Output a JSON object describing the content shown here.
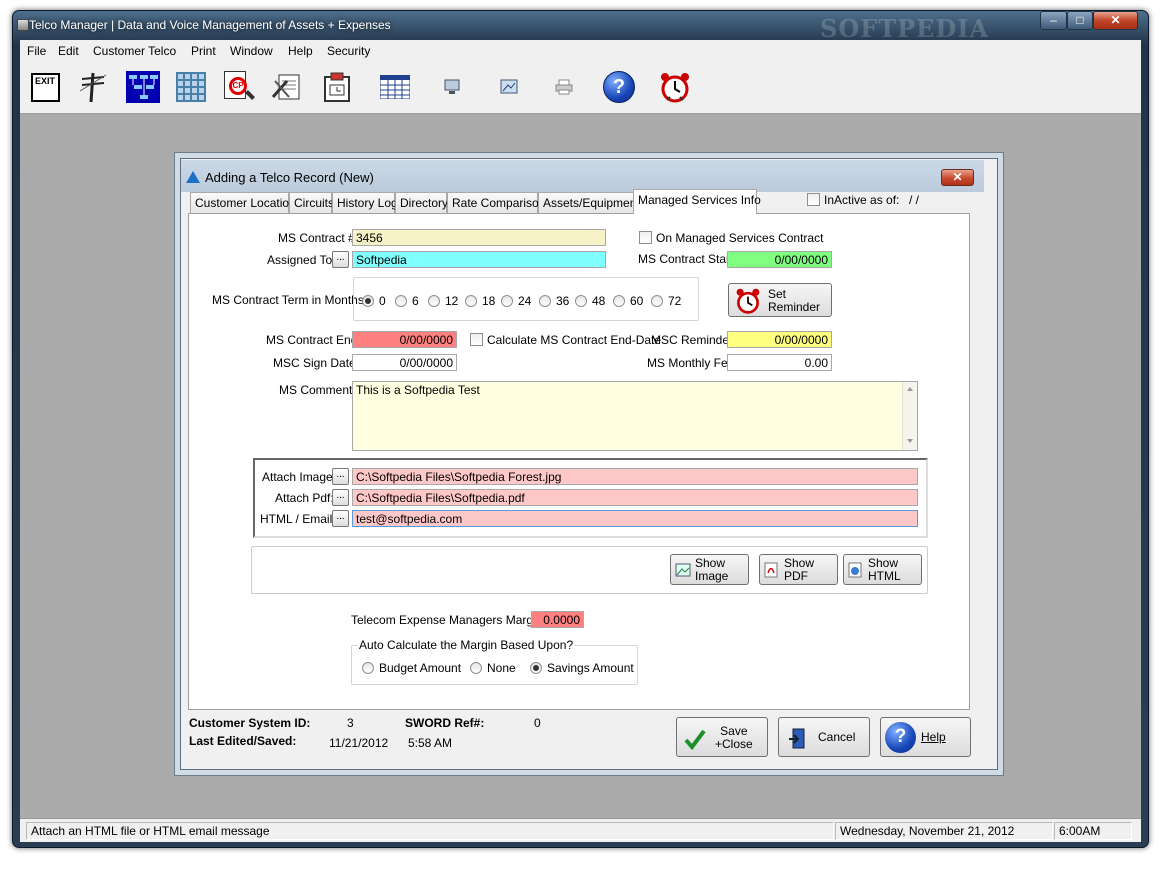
{
  "window": {
    "title": "Telco Manager | Data and Voice Management of Assets + Expenses",
    "watermark": "SOFTPEDIA",
    "min": "–",
    "max": "□",
    "close": "✕"
  },
  "menu": [
    "File",
    "Edit",
    "Customer Telco",
    "Print",
    "Window",
    "Help",
    "Security"
  ],
  "toolbar": [
    {
      "name": "exit-icon"
    },
    {
      "name": "telephone-pole-icon"
    },
    {
      "name": "network-diagram-icon"
    },
    {
      "name": "grid-icon"
    },
    {
      "name": "cp-search-icon"
    },
    {
      "name": "tools-document-icon"
    },
    {
      "name": "calendar-clipboard-icon"
    },
    {
      "name": "spreadsheet-icon"
    },
    {
      "name": "computer-icon"
    },
    {
      "name": "network-icon"
    },
    {
      "name": "printer-icon"
    },
    {
      "name": "help-icon"
    },
    {
      "name": "alarm-clock-icon"
    }
  ],
  "toolbar_labels": {
    "exit": "EXIT",
    "cp": "CP",
    "help": "?"
  },
  "dialog": {
    "title": "Adding a Telco Record  (New)",
    "close": "✕",
    "tabs": [
      "Customer Location",
      "Circuits",
      "History Log",
      "Directory",
      "Rate Comparison",
      "Assets/Equipment",
      "Managed Services Info"
    ],
    "inactive_label": "InActive as of:",
    "inactive_date": "/ /"
  },
  "form": {
    "ms_contract_label": "MS Contract #:",
    "ms_contract_value": "3456",
    "assigned_to_label": "Assigned To:",
    "assigned_to_value": "Softpedia",
    "on_managed_label": "On Managed Services Contract",
    "contract_start_label": "MS Contract Start:",
    "contract_start_value": "0/00/0000",
    "term_label": "MS Contract Term in Months:",
    "term_options": [
      "0",
      "6",
      "12",
      "18",
      "24",
      "36",
      "48",
      "60",
      "72"
    ],
    "term_selected": "0",
    "set_reminder": "Set\nReminder",
    "contract_end_label": "MS Contract End:",
    "contract_end_value": "0/00/0000",
    "calc_end_label": "Calculate MS Contract End-Date",
    "msc_reminder_label": "MSC Reminder:",
    "msc_reminder_value": "0/00/0000",
    "msc_sign_label": "MSC Sign Date:",
    "msc_sign_value": "0/00/0000",
    "monthly_fee_label": "MS Monthly Fee:",
    "monthly_fee_value": "0.00",
    "comments_label": "MS Comments:",
    "comments_value": "This is a Softpedia Test",
    "attach_image_label": "Attach Image:",
    "attach_image_value": "C:\\Softpedia Files\\Softpedia Forest.jpg",
    "attach_pdf_label": "Attach Pdf:",
    "attach_pdf_value": "C:\\Softpedia Files\\Softpedia.pdf",
    "html_email_label": "HTML / Email:",
    "html_email_value": "test@softpedia.com",
    "dots": "...",
    "show_image": "Show\nImage",
    "show_pdf": "Show\nPDF",
    "show_html": "Show\nHTML",
    "margin_label": "Telecom Expense Managers Margin:",
    "margin_value": "0.0000",
    "auto_calc_label": "Auto Calculate the Margin Based Upon?",
    "budget_label": "Budget Amount",
    "none_label": "None",
    "savings_label": "Savings Amount",
    "margin_basis_selected": "Savings Amount"
  },
  "footer": {
    "system_id_label": "Customer System ID:",
    "system_id_value": "3",
    "sword_label": "SWORD Ref#:",
    "sword_value": "0",
    "last_edited_label": "Last Edited/Saved:",
    "last_edited_date": "11/21/2012",
    "last_edited_time": "5:58 AM",
    "save_close": "Save\n+Close",
    "cancel": "Cancel",
    "help": "Help"
  },
  "status": {
    "message": "Attach an HTML file or HTML email message",
    "date": "Wednesday, November 21, 2012",
    "time": "6:00AM"
  },
  "colors": {
    "field_yellow": "#f5f2c8",
    "field_cyan": "#80ffff",
    "field_green": "#80ff80",
    "field_red": "#ff8080",
    "field_lightyellow": "#ffff80",
    "field_pink": "#ffc8c8",
    "comments_bg": "#ffffe1"
  }
}
